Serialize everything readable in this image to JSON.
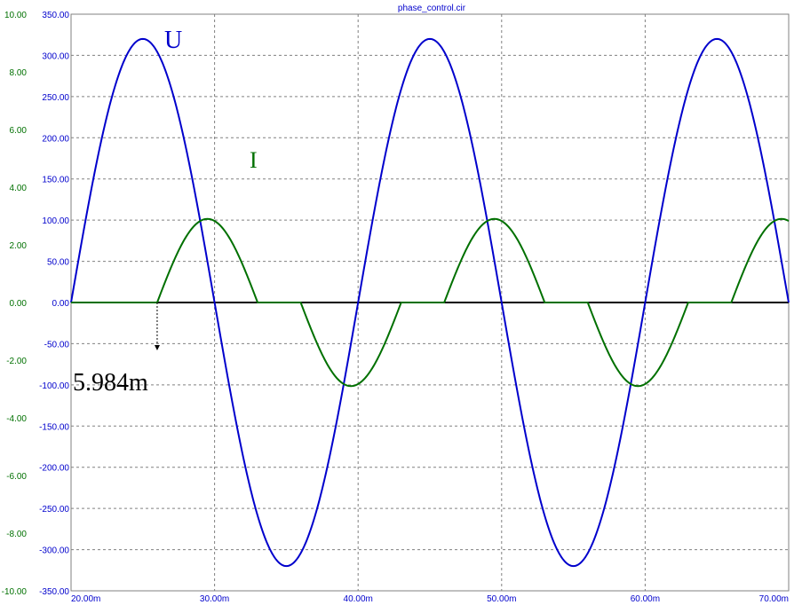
{
  "chart_data": {
    "type": "line",
    "title": "phase_control.cir",
    "x": {
      "range": [
        20,
        70
      ],
      "unit_suffix": "m",
      "ticks": [
        "20.00m",
        "30.00m",
        "40.00m",
        "50.00m",
        "60.00m",
        "70.00m"
      ]
    },
    "y_left": {
      "range": [
        -10,
        10
      ],
      "ticks": [
        "10.00",
        "8.00",
        "6.00",
        "4.00",
        "2.00",
        "0.00",
        "-2.00",
        "-4.00",
        "-6.00",
        "-8.00",
        "-10.00"
      ]
    },
    "y_right": {
      "range": [
        -350,
        350
      ],
      "ticks": [
        "350.00",
        "300.00",
        "250.00",
        "200.00",
        "150.00",
        "100.00",
        "50.00",
        "0.00",
        "-50.00",
        "-100.00",
        "-150.00",
        "-200.00",
        "-250.00",
        "-300.00",
        "-350.00"
      ]
    },
    "grid": true,
    "series": [
      {
        "name": "U",
        "color": "#0000cc",
        "axis": "right",
        "amplitude": 320,
        "period": 20,
        "zero_crossing": 20,
        "points": [
          [
            20,
            0
          ],
          [
            25,
            320
          ],
          [
            30,
            0
          ],
          [
            35,
            -320
          ],
          [
            40,
            0
          ],
          [
            45,
            320
          ],
          [
            50,
            0
          ],
          [
            55,
            -320
          ],
          [
            60,
            0
          ],
          [
            65,
            320
          ],
          [
            70,
            0
          ]
        ]
      },
      {
        "name": "I",
        "color": "#007000",
        "axis": "left",
        "amplitude": 2.9,
        "conduction_windows": [
          [
            26,
            33
          ],
          [
            36,
            43
          ],
          [
            46,
            53
          ],
          [
            56,
            63
          ],
          [
            66,
            70
          ]
        ],
        "points": [
          [
            26,
            0
          ],
          [
            29.5,
            2.9
          ],
          [
            33,
            0
          ],
          [
            36,
            0
          ],
          [
            39.5,
            -2.9
          ],
          [
            43,
            0
          ],
          [
            46,
            0
          ],
          [
            49.5,
            2.9
          ],
          [
            53,
            0
          ],
          [
            56,
            0
          ],
          [
            59.5,
            -2.9
          ],
          [
            63,
            0
          ],
          [
            66,
            0
          ],
          [
            69.5,
            2.9
          ],
          [
            70,
            2.85
          ]
        ]
      }
    ],
    "annotations": [
      {
        "text": "U",
        "color": "#0000cc"
      },
      {
        "text": "I",
        "color": "#007000"
      },
      {
        "text": "5.984m",
        "color": "#000000",
        "marker_x": 26
      }
    ]
  }
}
